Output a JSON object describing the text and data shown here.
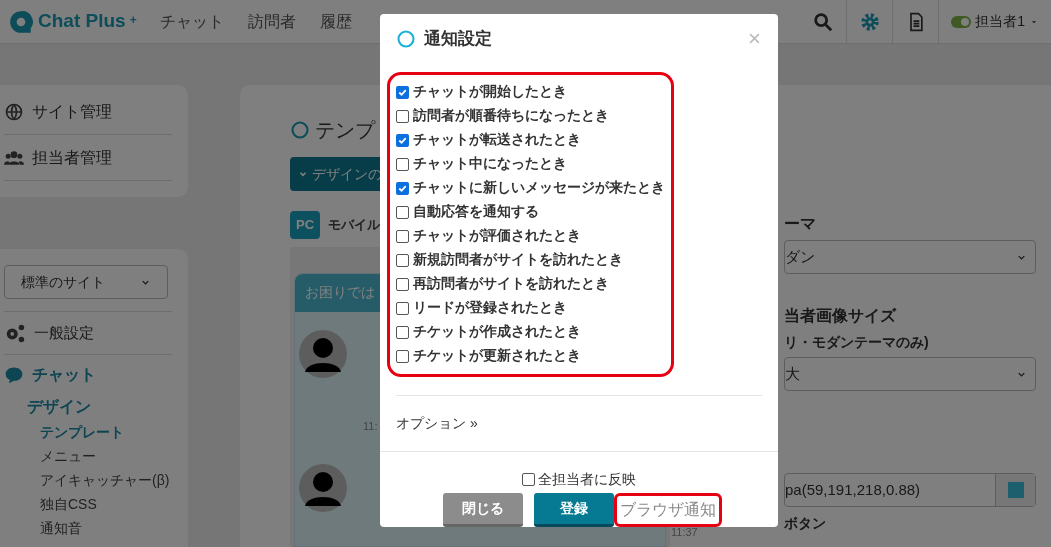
{
  "header": {
    "logo": "Chat Plus",
    "logo_mark": "+",
    "nav": [
      "チャット",
      "訪問者",
      "履歴"
    ],
    "user": "担当者1",
    "user_online": true
  },
  "sidebar": {
    "top_items": [
      "サイト管理",
      "担当者管理"
    ],
    "site_select": "標準のサイト",
    "general": "一般設定",
    "chat": "チャット",
    "design": "デザイン",
    "items": [
      {
        "label": "テンプレート",
        "selected": true
      },
      {
        "label": "メニュー",
        "selected": false
      },
      {
        "label": "アイキャッチャー(β)",
        "selected": false
      },
      {
        "label": "独自CSS",
        "selected": false
      },
      {
        "label": "通知音",
        "selected": false
      }
    ]
  },
  "content": {
    "heading": "テンプ",
    "design_button": "デザインの",
    "device_tabs": [
      {
        "label": "PC",
        "selected": true
      },
      {
        "label": "モバイル",
        "selected": false
      }
    ],
    "preview_header": "お困りでは",
    "times": [
      "11:",
      "11:37"
    ],
    "theme_label": "ーマ",
    "theme_value": "ダン",
    "size_label": "当者画像サイズ",
    "size_note": "リ・モダンテーマのみ)",
    "size_value": "大",
    "color_value": "pa(59,191,218,0.88)",
    "button_label": "ボタン"
  },
  "modal": {
    "title": "通知設定",
    "options": [
      {
        "label": "チャットが開始したとき",
        "checked": true
      },
      {
        "label": "訪問者が順番待ちになったとき",
        "checked": false
      },
      {
        "label": "チャットが転送されたとき",
        "checked": true
      },
      {
        "label": "チャット中になったとき",
        "checked": false
      },
      {
        "label": "チャットに新しいメッセージが来たとき",
        "checked": true
      },
      {
        "label": "自動応答を通知する",
        "checked": false
      },
      {
        "label": "チャットが評価されたとき",
        "checked": false
      },
      {
        "label": "新規訪問者がサイトを訪れたとき",
        "checked": false
      },
      {
        "label": "再訪問者がサイトを訪れたとき",
        "checked": false
      },
      {
        "label": "リードが登録されたとき",
        "checked": false
      },
      {
        "label": "チケットが作成されたとき",
        "checked": false
      },
      {
        "label": "チケットが更新されたとき",
        "checked": false
      }
    ],
    "options_link": "オプション »",
    "apply_all": {
      "label": "全担当者に反映",
      "checked": false
    },
    "close_button": "閉じる",
    "save_button": "登録",
    "browser_button": "ブラウザ通知"
  }
}
